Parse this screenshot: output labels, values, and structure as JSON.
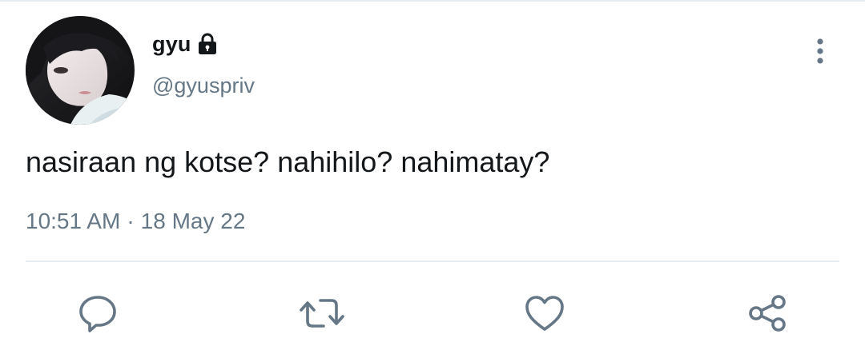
{
  "user": {
    "display_name": "gyu",
    "handle": "@gyuspriv",
    "avatar_icon": "avatar-photo",
    "protected_icon": "lock-icon"
  },
  "tweet": {
    "text": "nasiraan ng kotse? nahihilo? nahimatay?",
    "time": "10:51 AM",
    "separator": "·",
    "date": "18 May 22"
  },
  "actions": {
    "reply_icon": "reply-icon",
    "retweet_icon": "retweet-icon",
    "like_icon": "heart-icon",
    "share_icon": "share-icon",
    "more_icon": "more-vertical-icon"
  },
  "colors": {
    "text_primary": "#14171a",
    "text_secondary": "#657786",
    "divider": "#e6ecf0",
    "icon": "#657786"
  }
}
